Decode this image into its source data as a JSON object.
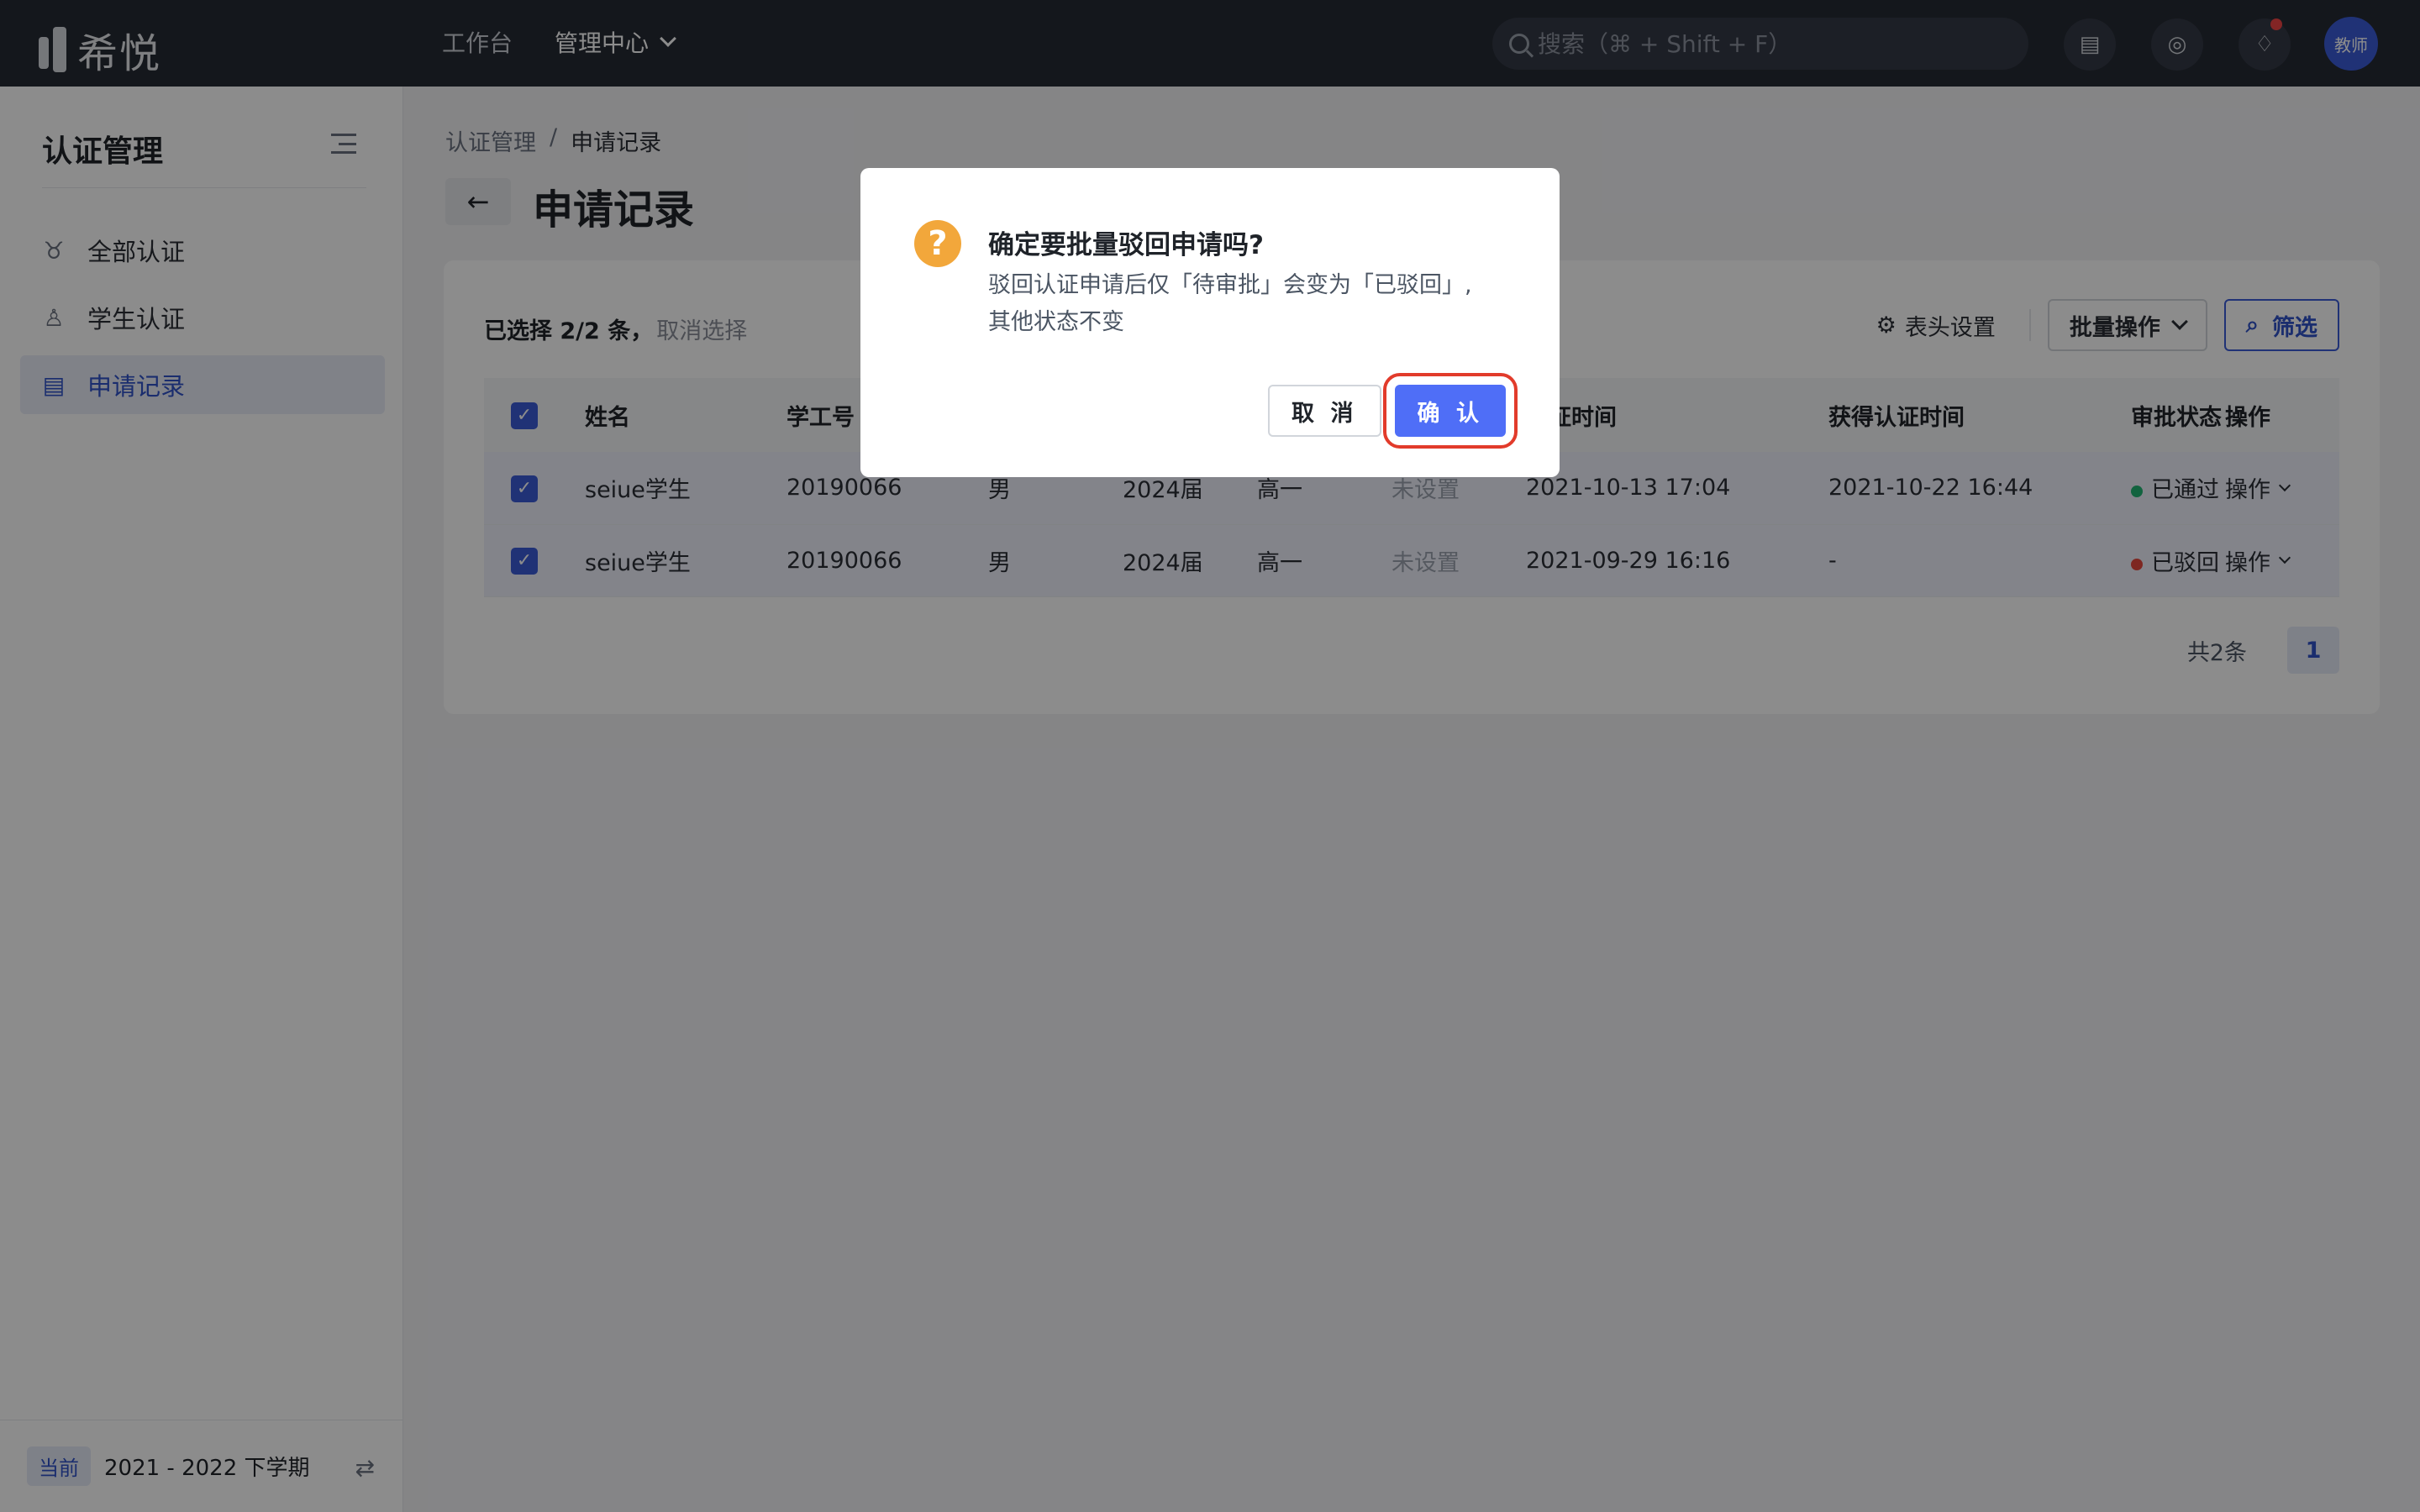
{
  "app": {
    "name": "希悦"
  },
  "topnav": {
    "items": [
      {
        "label": "工作台"
      },
      {
        "label": "管理中心"
      }
    ],
    "search_placeholder": "搜索（⌘ + Shift + F）",
    "avatar_label": "教师"
  },
  "sidebar": {
    "title": "认证管理",
    "items": [
      {
        "label": "全部认证",
        "icon": "medal-icon"
      },
      {
        "label": "学生认证",
        "icon": "user-icon"
      },
      {
        "label": "申请记录",
        "icon": "document-icon"
      }
    ],
    "footer": {
      "tag": "当前",
      "term": "2021 - 2022 下学期"
    }
  },
  "breadcrumb": {
    "parent": "认证管理",
    "separator": "/",
    "current": "申请记录"
  },
  "page": {
    "title": "申请记录"
  },
  "toolbar": {
    "selection_text": "已选择 2/2 条，",
    "cancel_selection": "取消选择",
    "header_settings": "表头设置",
    "batch_ops": "批量操作",
    "filter": "筛选"
  },
  "table": {
    "headers": [
      "姓名",
      "学工号",
      "",
      "",
      "",
      "",
      "认证时间",
      "获得认证时间",
      "审批状态",
      "操作"
    ],
    "rows": [
      {
        "name": "seiue学生",
        "id": "20190066",
        "gender": "男",
        "grade": "2024届",
        "class": "高一",
        "unset": "未设置",
        "apply_time": "2021-10-13 17:04",
        "get_time": "2021-10-22 16:44",
        "status": "已通过",
        "status_color": "#22b573",
        "op": "操作"
      },
      {
        "name": "seiue学生",
        "id": "20190066",
        "gender": "男",
        "grade": "2024届",
        "class": "高一",
        "unset": "未设置",
        "apply_time": "2021-09-29 16:16",
        "get_time": "-",
        "status": "已驳回",
        "status_color": "#e5483d",
        "op": "操作"
      }
    ]
  },
  "pagination": {
    "total": "共2条",
    "current": "1"
  },
  "dialog": {
    "title": "确定要批量驳回申请吗?",
    "body_line1": "驳回认证申请后仅「待审批」会变为「已驳回」,",
    "body_line2": "其他状态不变",
    "cancel": "取 消",
    "confirm": "确 认"
  },
  "colors": {
    "primary": "#4f6ef7",
    "highlight": "#e23b2b",
    "warning": "#f2a73b"
  }
}
